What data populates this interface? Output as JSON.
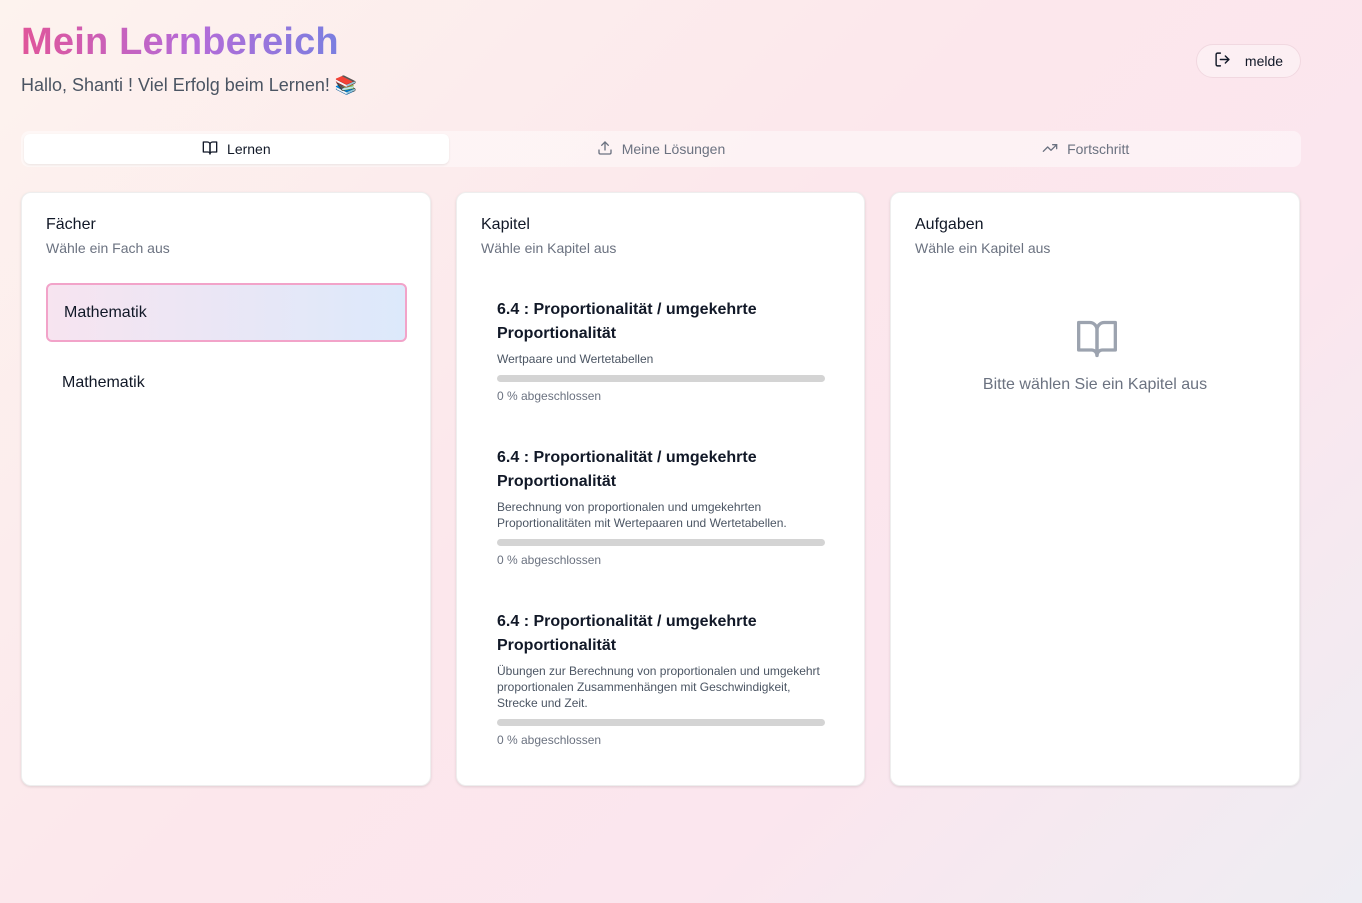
{
  "header": {
    "title": "Mein Lernbereich",
    "greeting": "Hallo, Shanti ! Viel Erfolg beim Lernen! 📚",
    "logout_label": "melde"
  },
  "tabs": [
    {
      "label": "Lernen",
      "icon": "book-open-icon",
      "active": true
    },
    {
      "label": "Meine Lösungen",
      "icon": "upload-icon",
      "active": false
    },
    {
      "label": "Fortschritt",
      "icon": "trending-up-icon",
      "active": false
    }
  ],
  "subjects_panel": {
    "title": "Fächer",
    "description": "Wähle ein Fach aus",
    "items": [
      {
        "label": "Mathematik",
        "selected": true
      },
      {
        "label": "Mathematik",
        "selected": false
      }
    ]
  },
  "chapters_panel": {
    "title": "Kapitel",
    "description": "Wähle ein Kapitel aus",
    "items": [
      {
        "title": "6.4 : Proportionalität / umgekehrte Proportionalität",
        "description": "Wertpaare und Wertetabellen",
        "progress": 0,
        "progress_label": "0 % abgeschlossen"
      },
      {
        "title": "6.4 : Proportionalität / umgekehrte Proportionalität",
        "description": "Berechnung von proportionalen und umgekehrten Proportionalitäten mit Wertepaaren und Wertetabellen.",
        "progress": 0,
        "progress_label": "0 % abgeschlossen"
      },
      {
        "title": "6.4 : Proportionalität / umgekehrte Proportionalität",
        "description": "Übungen zur Berechnung von proportionalen und umgekehrt proportionalen Zusammenhängen mit Geschwindigkeit, Strecke und Zeit.",
        "progress": 0,
        "progress_label": "0 % abgeschlossen"
      }
    ]
  },
  "tasks_panel": {
    "title": "Aufgaben",
    "description": "Wähle ein Kapitel aus",
    "empty_icon": "book-open-icon",
    "empty_text": "Bitte wählen Sie ein Kapitel aus"
  },
  "colors": {
    "title_gradient_start": "#e0559a",
    "title_gradient_end": "#7a7fe0",
    "selected_border": "#f2a3c9",
    "progress_track": "#d4d4d4"
  }
}
